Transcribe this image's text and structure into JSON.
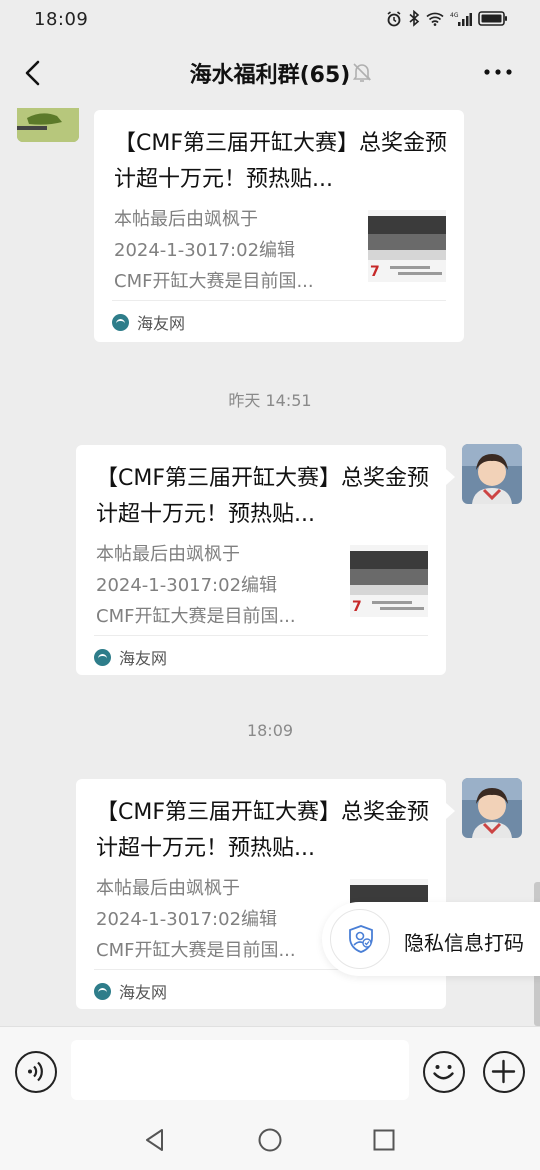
{
  "status_bar": {
    "time": "18:09",
    "icons": [
      "alarm-icon",
      "bluetooth-icon",
      "wifi-icon",
      "signal-4g-icon",
      "battery-icon"
    ]
  },
  "header": {
    "title": "海水福利群(65)",
    "icons": [
      "back-icon",
      "mute-bell-icon",
      "more-icon"
    ]
  },
  "messages": [
    {
      "side": "left",
      "title": "【CMF第三届开缸大赛】总奖金预计超十万元！预热贴...",
      "desc_line1": "本帖最后由飒枫于",
      "desc_line2": "2024-1-3017:02编辑",
      "desc_line3": "CMF开缸大赛是目前国...",
      "source": "海友网"
    },
    {
      "time": "昨天 14:51",
      "side": "right",
      "title": "【CMF第三届开缸大赛】总奖金预计超十万元！预热贴...",
      "desc_line1": "本帖最后由飒枫于",
      "desc_line2": "2024-1-3017:02编辑",
      "desc_line3": "CMF开缸大赛是目前国...",
      "source": "海友网"
    },
    {
      "time": "18:09",
      "side": "right",
      "title": "【CMF第三届开缸大赛】总奖金预计超十万元！预热贴...",
      "desc_line1": "本帖最后由飒枫于",
      "desc_line2": "2024-1-3017:02编辑",
      "desc_line3": "CMF开缸大赛是目前国...",
      "source": "海友网"
    }
  ],
  "privacy": {
    "label": "隐私信息打码",
    "icon": "shield-user-icon"
  },
  "input_bar": {
    "value": "",
    "icons": [
      "voice-icon",
      "emoji-icon",
      "plus-icon"
    ]
  },
  "nav_bar": {
    "icons": [
      "nav-back-icon",
      "nav-home-icon",
      "nav-recent-icon"
    ]
  },
  "colors": {
    "background": "#ededed",
    "bubble": "#ffffff",
    "secondary_text": "#808080"
  }
}
